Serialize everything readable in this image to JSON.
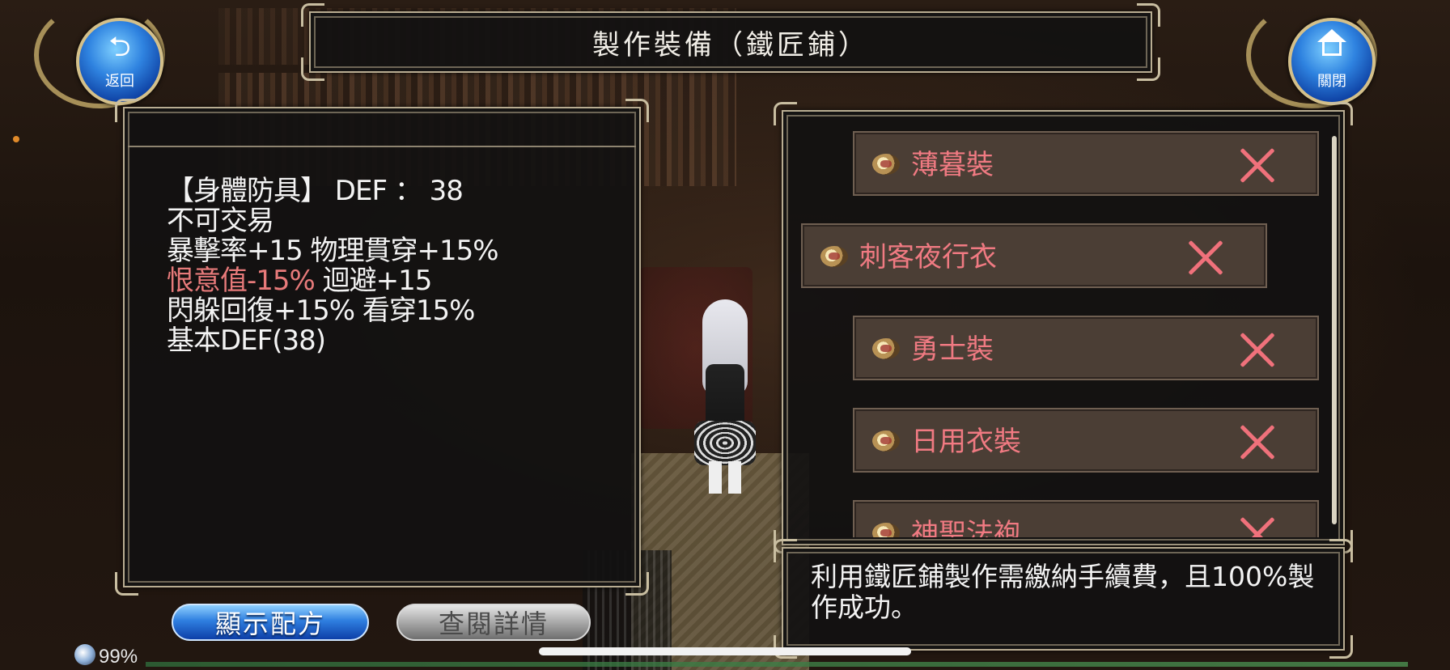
{
  "title": "製作裝備（鐵匠鋪）",
  "nav": {
    "back_label": "返回",
    "close_label": "關閉",
    "back_icon": "undo-arrow-icon",
    "close_icon": "home-icon"
  },
  "item_info": {
    "lines": [
      "【身體防具】 DEF ： 38",
      "不可交易",
      "暴擊率+15 物理貫穿+15%"
    ],
    "negative_stat": "恨意值-15%",
    "line4_rest": " 迴避+15",
    "lines_after": [
      "閃躲回復+15% 看穿15%",
      "基本DEF(38)"
    ]
  },
  "recipe_list": [
    {
      "name": "薄暮裝",
      "selected": false
    },
    {
      "name": "刺客夜行衣",
      "selected": true
    },
    {
      "name": "勇士裝",
      "selected": false
    },
    {
      "name": "日用衣裝",
      "selected": false
    },
    {
      "name": "神聖法袍",
      "selected": false
    }
  ],
  "description": "利用鐵匠鋪製作需繳納手續費，且100%製作成功。",
  "buttons": {
    "show_recipe": "顯示配方",
    "view_details": "查閱詳情"
  },
  "status": {
    "battery": "99%"
  },
  "colors": {
    "item_name": "#f07a82",
    "negative_stat": "#e77a7a",
    "primary_button": "#2f7fe0",
    "disabled_button": "#a9a9a9"
  }
}
